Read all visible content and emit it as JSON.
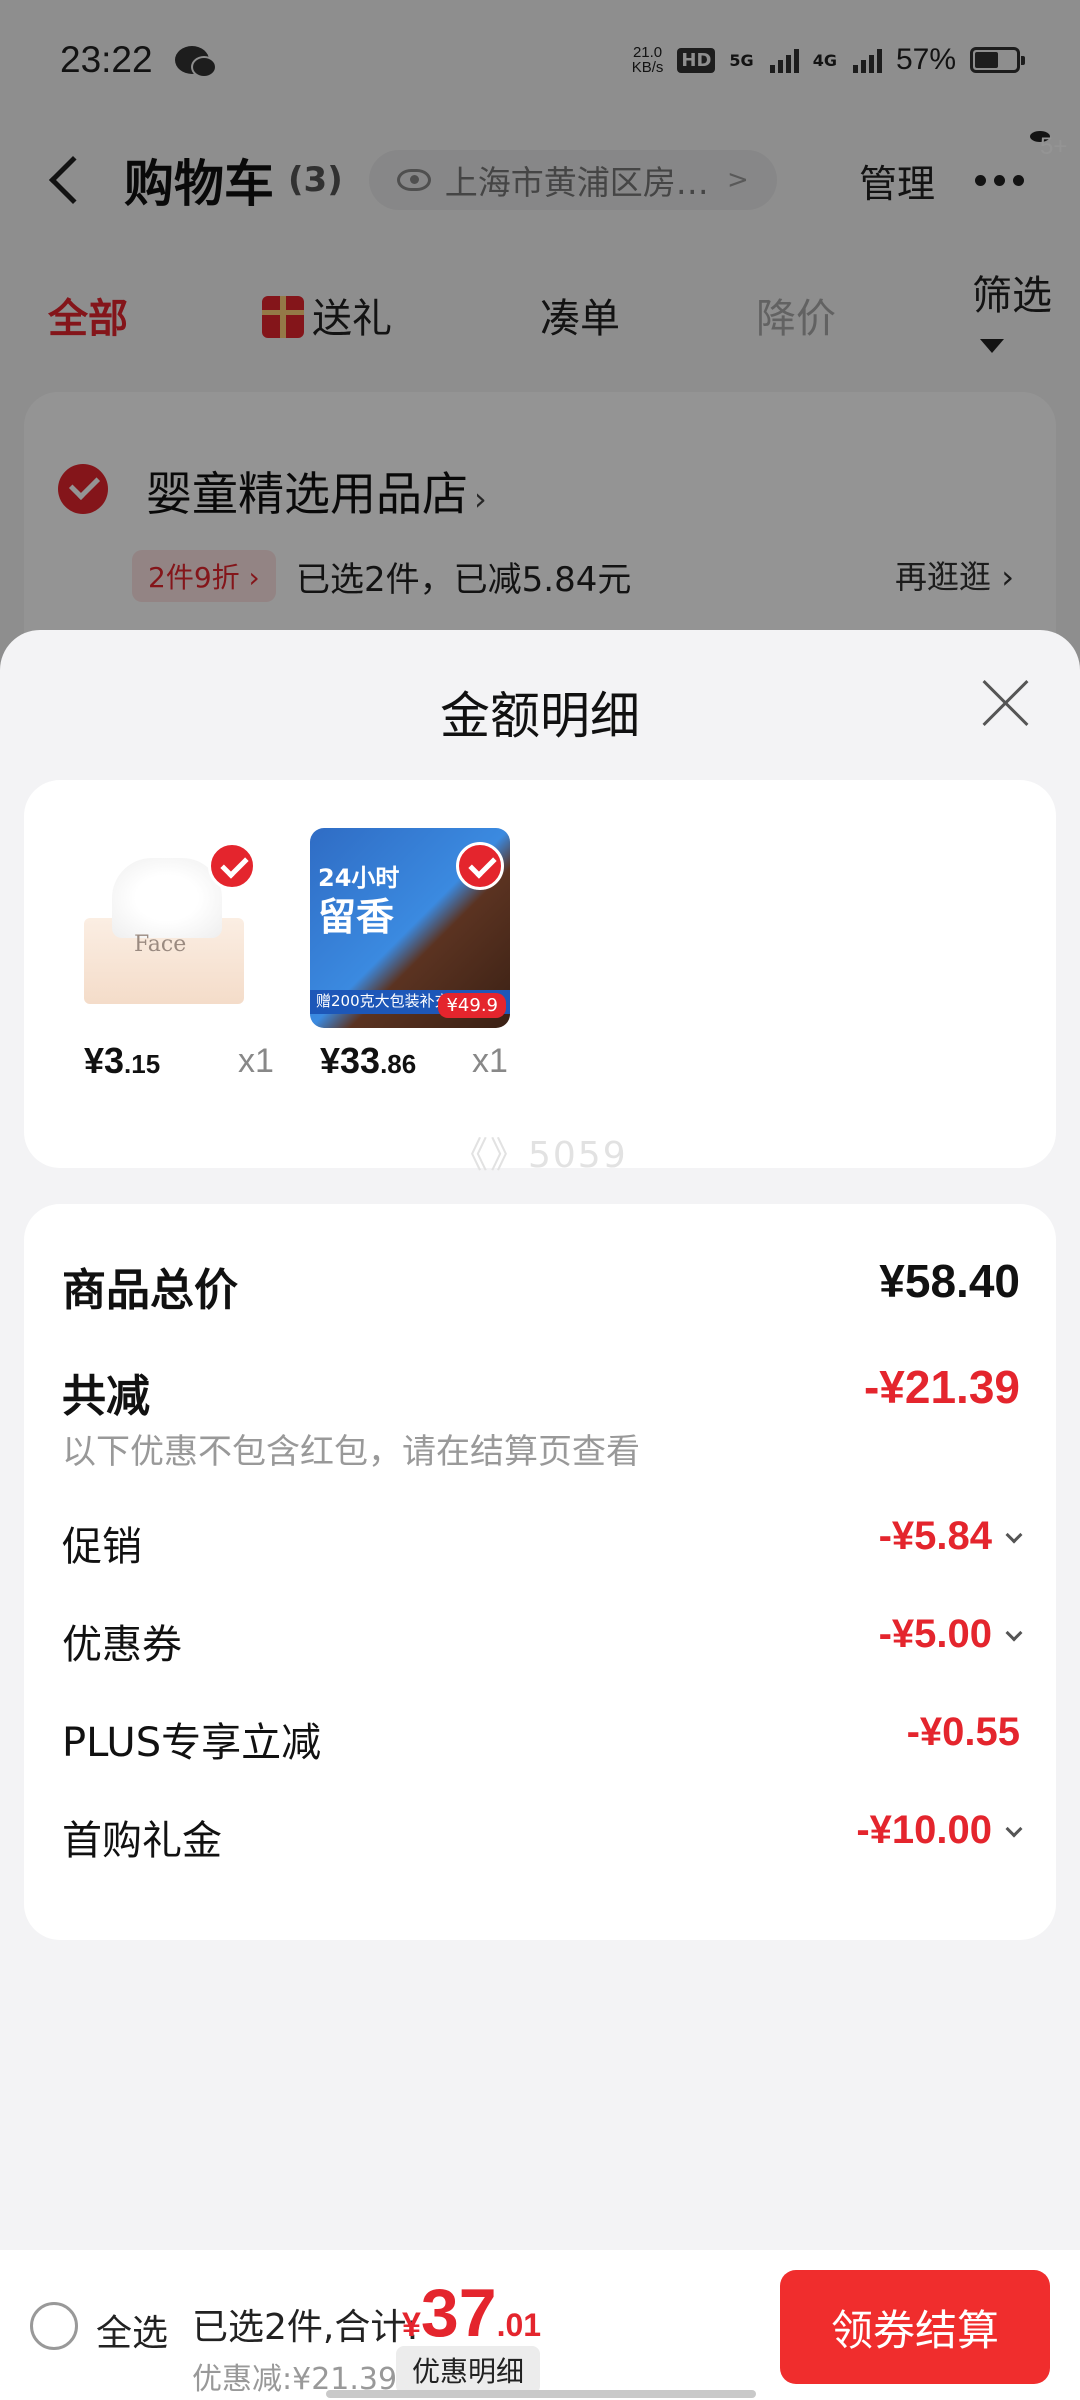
{
  "status_bar": {
    "time": "23:22",
    "net_speed_value": "21.0",
    "net_speed_unit": "KB/s",
    "hd": "HD",
    "sim1": "5G",
    "sim2": "4G",
    "battery": "57%"
  },
  "header": {
    "title": "购物车",
    "count": "(3)",
    "location": "上海市黄浦区房…",
    "manage": "管理",
    "badge": "5+"
  },
  "filter_tabs": [
    "全部",
    "送礼",
    "凑单",
    "降价",
    "筛选"
  ],
  "store": {
    "name": "婴童精选用品店",
    "promo_tag": "2件9折 ›",
    "promo_text": "已选2件，已减5.84元",
    "browse_more": "再逛逛 ›"
  },
  "sheet": {
    "title": "金额明细",
    "products": [
      {
        "thumb_label": "Face",
        "price_int": "¥3",
        "price_dec": ".15",
        "qty": "x1"
      },
      {
        "thumb_line1": "24小时",
        "thumb_line2": "留香",
        "thumb_banner": "赠200克大包装补充装",
        "thumb_price": "¥49.9",
        "price_int": "¥33",
        "price_dec": ".86",
        "qty": "x1"
      }
    ],
    "watermark": "《》5059",
    "summary": {
      "total_label": "商品总价",
      "total_value": "¥58.40",
      "reduce_label": "共减",
      "reduce_value": "-¥21.39",
      "reduce_note": "以下优惠不包含红包，请在结算页查看",
      "rows": [
        {
          "label": "促销",
          "value": "-¥5.84"
        },
        {
          "label": "优惠券",
          "value": "-¥5.00"
        },
        {
          "label": "PLUS专享立减",
          "value": "-¥0.55"
        },
        {
          "label": "首购礼金",
          "value": "-¥10.00"
        }
      ]
    }
  },
  "checkout": {
    "select_all": "全选",
    "summary_prefix": "已选2件,合计:",
    "currency": "¥",
    "total_int": "37",
    "total_dec": ".01",
    "discount": "优惠减:¥21.39",
    "detail_button": "优惠明细",
    "checkout_button": "领券结算"
  },
  "colors": {
    "accent": "#e4252d",
    "checkout_button": "#f02d2d"
  }
}
